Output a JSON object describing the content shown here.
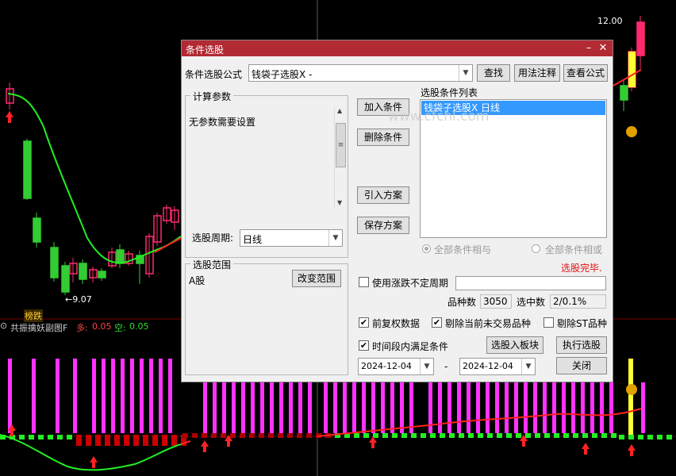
{
  "chart": {
    "price_high": "12.00",
    "price_low": "←9.07",
    "hot_tag": "榜跌",
    "indicator_name": "共振擒妖副图F",
    "duo_label": "多:",
    "duo_value": "0.05",
    "kong_label": "空:",
    "kong_value": "0.05",
    "colors": {
      "bull": "#ff2a6e",
      "bear": "#33cc33",
      "line_red": "#ff2222",
      "line_green": "#22ee22",
      "magenta": "#ff33ff"
    }
  },
  "dialog": {
    "title": "条件选股",
    "formula_label": "条件选股公式",
    "formula_value": "钱袋子选股X  -",
    "find_button": "查找",
    "usage_button": "用法注释",
    "view_formula_button": "查看公式",
    "calc_params_title": "计算参数",
    "no_params_text": "无参数需要设置",
    "add_condition_button": "加入条件",
    "delete_condition_button": "删除条件",
    "import_plan_button": "引入方案",
    "save_plan_button": "保存方案",
    "condition_list_title": "选股条件列表",
    "condition_list": [
      "钱袋子选股X  日线"
    ],
    "watermark": "www.cfchl.com",
    "period_label": "选股周期:",
    "period_value": "日线",
    "radio_and": "全部条件相与",
    "radio_or": "全部条件相或",
    "status_text": "选股完毕.",
    "range_title": "选股范围",
    "range_value": "A股",
    "change_range_button": "改变范围",
    "use_variable_period": "使用涨跌不定周期",
    "count_label": "品种数",
    "count_value": "3050",
    "selected_label": "选中数",
    "selected_value": "2/0.1%",
    "pre_rights": "前复权数据",
    "remove_untraded": "剔除当前未交易品种",
    "remove_st": "剔除ST品种",
    "time_range_condition": "时间段内满足条件",
    "to_block_button": "选股入板块",
    "execute_button": "执行选股",
    "date_from": "2024-12-04",
    "date_sep": "-",
    "date_to": "2024-12-04",
    "close_button": "关闭",
    "check_states": {
      "use_variable_period": false,
      "pre_rights": true,
      "remove_untraded": true,
      "remove_st": false,
      "time_range_condition": true
    },
    "colors": {
      "title_bg": "#b22a33",
      "list_selected": "#3399ff",
      "status": "#e01010"
    }
  }
}
